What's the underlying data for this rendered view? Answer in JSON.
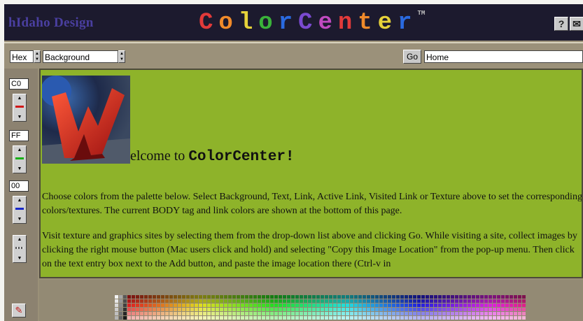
{
  "header": {
    "brand": "hIdaho Design",
    "logo_letters": [
      {
        "ch": "C",
        "color": "#e23a3a"
      },
      {
        "ch": "o",
        "color": "#f08a2a"
      },
      {
        "ch": "l",
        "color": "#e6d23a"
      },
      {
        "ch": "o",
        "color": "#3ab23a"
      },
      {
        "ch": "r",
        "color": "#2a6ae0"
      },
      {
        "ch": "C",
        "color": "#7a4ad0"
      },
      {
        "ch": "e",
        "color": "#c04ac0"
      },
      {
        "ch": "n",
        "color": "#e23a3a"
      },
      {
        "ch": "t",
        "color": "#f08a2a"
      },
      {
        "ch": "e",
        "color": "#e6d23a"
      },
      {
        "ch": "r",
        "color": "#2a6ae0"
      }
    ],
    "trademark": "TM",
    "help_label": "?",
    "mail_label": "✉"
  },
  "controls": {
    "format_value": "Hex",
    "target_value": "Background",
    "go_label": "Go",
    "location_value": "Home"
  },
  "rgb": {
    "red": "C0",
    "green": "FF",
    "blue": "00"
  },
  "content": {
    "welcome_prefix": "elcome to ",
    "welcome_bold": "ColorCenter!",
    "paragraph1": "Choose colors from the palette below. Select Background, Text, Link, Active Link, Visited Link or Texture above to set the corresponding colors/textures. The current BODY tag and link colors are shown at the bottom of this page.",
    "paragraph2": "Visit texture and graphics sites by selecting them from the drop-down list above and clicking Go. While visiting a site, collect images by clicking the right mouse button (Mac users click and hold) and selecting \"Copy this Image Location\" from the pop-up menu. Then click on the text entry box next to the Add button, and paste the image location there (Ctrl-v in"
  },
  "colors": {
    "content_bg": "#8eb32a",
    "header_bg": "#1c1a2e",
    "frame_bg": "#9a9078"
  }
}
